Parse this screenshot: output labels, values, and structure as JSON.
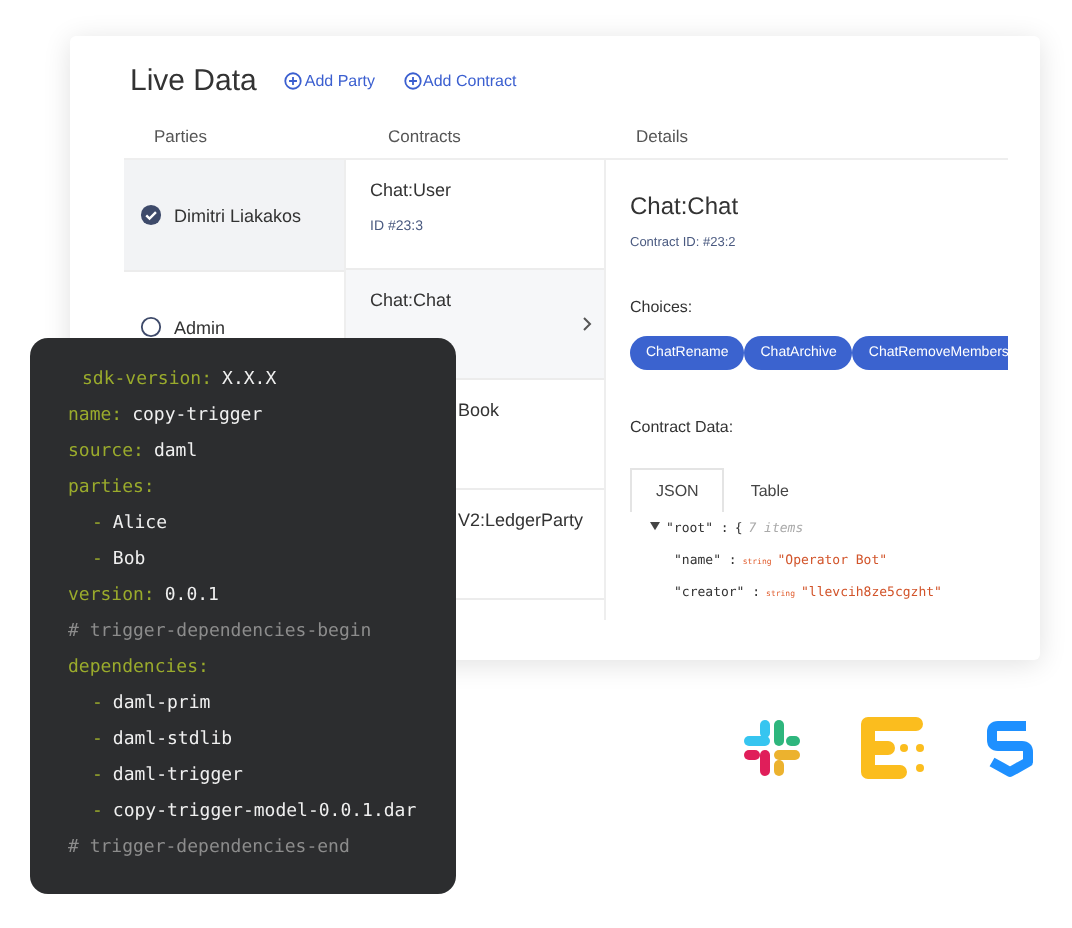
{
  "header": {
    "title": "Live Data",
    "actions": [
      "Add Party",
      "Add Contract"
    ]
  },
  "columns": [
    "Parties",
    "Contracts",
    "Details"
  ],
  "parties": [
    {
      "name": "Dimitri Liakakos",
      "selected": true
    },
    {
      "name": "Admin",
      "selected": false
    }
  ],
  "contracts": [
    {
      "kind": "full",
      "name": "Chat:User",
      "id": "ID #23:3",
      "selected": false
    },
    {
      "kind": "full",
      "name": "Chat:Chat",
      "selected": true
    },
    {
      "kind": "partial",
      "name": "Book",
      "selected": false
    },
    {
      "kind": "partial",
      "name": "V2:LedgerParty",
      "selected": false
    }
  ],
  "details": {
    "title": "Chat:Chat",
    "contract_id": "Contract ID: #23:2",
    "choices_label": "Choices:",
    "choices": [
      "ChatRename",
      "ChatArchive",
      "ChatRemoveMembers"
    ],
    "data_label": "Contract Data:",
    "tabs": [
      {
        "label": "JSON",
        "selected": true
      },
      {
        "label": "Table",
        "selected": false
      }
    ],
    "tree": {
      "key": "\"root\" :",
      "open": "{",
      "count": "7 items",
      "expanded": true,
      "children": [
        {
          "key": "\"name\" :",
          "type": "string",
          "value": "\"Operator Bot\""
        },
        {
          "key": "\"creator\" :",
          "type": "string",
          "value": "\"llevcih8ze5cgzht\""
        }
      ]
    }
  },
  "code": [
    {
      "kind": "pair",
      "key": "sdk-version:",
      "value": "X.X.X"
    },
    {
      "kind": "pair",
      "key": "name:",
      "value": "copy-trigger"
    },
    {
      "kind": "pair",
      "key": "source:",
      "value": "daml"
    },
    {
      "kind": "pair",
      "key": "parties:"
    },
    {
      "kind": "item",
      "dash": "-",
      "value": "Alice"
    },
    {
      "kind": "item",
      "dash": "-",
      "value": "Bob"
    },
    {
      "kind": "pair",
      "key": "version:",
      "value": "0.0.1"
    },
    {
      "kind": "comment",
      "value": "# trigger-dependencies-begin"
    },
    {
      "kind": "pair",
      "key": "dependencies:"
    },
    {
      "kind": "item",
      "dash": "-",
      "value": "daml-prim"
    },
    {
      "kind": "item",
      "dash": "-",
      "value": "daml-stdlib"
    },
    {
      "kind": "item",
      "dash": "-",
      "value": "daml-trigger"
    },
    {
      "kind": "item",
      "dash": "-",
      "value": "copy-trigger-model-0.0.1.dar"
    },
    {
      "kind": "comment",
      "value": "# trigger-dependencies-end"
    }
  ]
}
